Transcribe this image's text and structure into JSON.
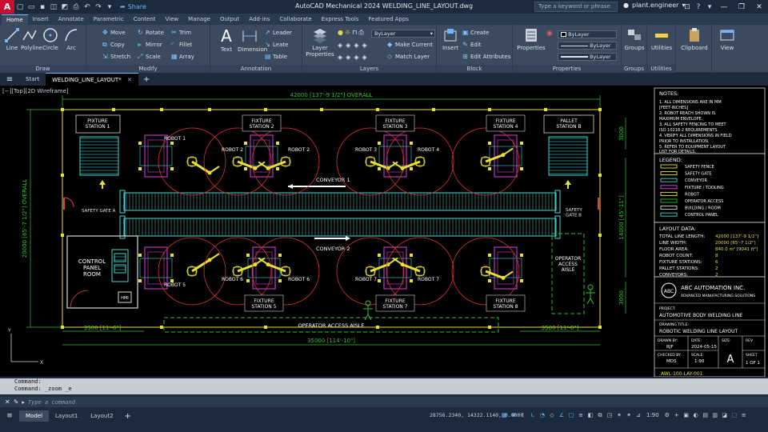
{
  "app": {
    "logo_letter": "A",
    "window_title": "AutoCAD Mechanical 2024    WELDING_LINE_LAYOUT.dwg",
    "share_label": "Share",
    "search_placeholder": "Type a keyword or phrase",
    "username": "plant.engineer"
  },
  "ribbon_tabs": [
    "Home",
    "Insert",
    "Annotate",
    "Parametric",
    "Content",
    "View",
    "Manage",
    "Output",
    "Add-ins",
    "Collaborate",
    "Express Tools",
    "Featured Apps"
  ],
  "ribbon": {
    "draw": {
      "title": "Draw",
      "tools": [
        "Line",
        "Polyline",
        "Circle",
        "Arc"
      ]
    },
    "modify": {
      "title": "Modify",
      "tools": [
        "Move",
        "Rotate",
        "Trim",
        "Copy",
        "Mirror",
        "Fillet",
        "Stretch",
        "Scale",
        "Array"
      ]
    },
    "annotation": {
      "title": "Annotation",
      "tools": [
        "Text",
        "Dimension",
        "Leader",
        "Leate",
        "Table"
      ]
    },
    "layers": {
      "title": "Layers",
      "layer_properties": "Layer Properties",
      "current_layer": "ByLayer",
      "make_current": "Make Current",
      "match_layer": "Match Layer"
    },
    "block": {
      "title": "Block",
      "insert": "Insert",
      "create": "Create",
      "edit": "Edit",
      "edit_attributes": "Edit Attributes"
    },
    "properties": {
      "title": "Properties",
      "label": "Properties",
      "color": "ByLayer",
      "linetype": "ByLayer",
      "lineweight": "ByLayer"
    },
    "groups": {
      "title": "Groups",
      "label": "Groups"
    },
    "utilities": {
      "title": "Utilities",
      "label": "Utilities"
    },
    "clipboard": {
      "label": "Clipboard"
    },
    "view": {
      "label": "View"
    }
  },
  "file_tabs": {
    "start": "Start",
    "active": "WELDING_LINE_LAYOUT*"
  },
  "viewport_label": "[−][Top][2D Wireframe]",
  "drawing": {
    "overall_top": "42000 [137'-9 1/2\"] OVERALL",
    "overall_left": "20000 [65'-7 1/2\"] OVERALL",
    "overall_right": "14000 [45'-11\"]",
    "dim_bottom_total": "35000 [114'-10\"]",
    "dim_bottom_left": "3500 [11'-6\"]",
    "dim_bottom_right": "3500 [11'-6\"]",
    "dim_right_top": "3000",
    "dim_right_bottom": "3000",
    "stations_top": [
      "PIXTURE\nSTATION 1",
      "FIXTURE\nSTATION 2",
      "FIXTURE\nSTATION 3",
      "FIXTURE\nSTATION 4",
      "PALLET\nSTATION B"
    ],
    "stations_bottom": [
      "FIXTURE\nSTATION 5",
      "FIXTURE\nSTATION 7",
      "FIXTURE\nSTATION 8"
    ],
    "robots_top": [
      "ROBOT 1",
      "ROBOT 2",
      "ROBOT 2",
      "ROBOT 3",
      "ROBOT 4"
    ],
    "robots_bottom": [
      "ROBOT 5",
      "ROBOT 6",
      "ROBOT 6",
      "ROBOT 7",
      "ROBOT 7"
    ],
    "conveyor_1": "CONVEYOR 1",
    "conveyor_2": "CONVEYOR 2",
    "safety_gate_a": "SAFETY GATE A",
    "safety_gate_b": "SAFETY\nGATE B",
    "control_room": "CONTROL\nPANEL\nROOM",
    "hmi": "HMI",
    "operator_access": "OPERATOR\nACCESS\nAISLE",
    "operator_aisle": "OPERATOR ACCESS AISLE"
  },
  "notes": {
    "title": "NOTES:",
    "items": [
      "1.  ALL DIMENSIONS ARE IN MM",
      "     [FEET-INCHES]",
      "2.  ROBOT REACH SHOWN IS",
      "     MAXIMUM ENVELOPE.",
      "3.  ALL SAFETY FENCING TO MEET",
      "     ISO 10218-2 REQUIREMENTS.",
      "4.  VERIFY ALL DIMENSIONS IN FIELD",
      "     PRIOR TO INSTALLATION.",
      "5.  REFER TO EQUIPMENT LAYOUT",
      "     LIST FOR DETAILS."
    ]
  },
  "legend": {
    "title": "LEGEND:",
    "items": [
      {
        "label": "SAFETY FENCE",
        "color": "#e8e032"
      },
      {
        "label": "SAFETY GATE",
        "color": "#e8e032"
      },
      {
        "label": "CONVEYOR",
        "color": "#3fd4d4"
      },
      {
        "label": "FIXTURE / TOOLING",
        "color": "#e040e0"
      },
      {
        "label": "ROBOT",
        "color": "#e8e032"
      },
      {
        "label": "OPERATOR ACCESS",
        "color": "#30c030"
      },
      {
        "label": "BUILDING / ROOM",
        "color": "#d8d8d8"
      },
      {
        "label": "CONTROL PANEL",
        "color": "#3fd4d4"
      }
    ]
  },
  "layout_data": {
    "title": "LAYOUT DATA:",
    "rows": [
      {
        "k": "TOTAL LINE LENGTH:",
        "v": "42000 [137'-9 1/2\"]"
      },
      {
        "k": "LINE WIDTH:",
        "v": "20000 [65'-7 1/2\"]"
      },
      {
        "k": "FLOOR AREA:",
        "v": "840.0 m² [9041 ft²]"
      },
      {
        "k": "ROBOT COUNT:",
        "v": "8"
      },
      {
        "k": "FIXTURE STATIONS:",
        "v": "6"
      },
      {
        "k": "PALLET STATIONS:",
        "v": "2"
      },
      {
        "k": "CONVEYORS:",
        "v": "2"
      }
    ]
  },
  "title_block": {
    "logo": "ABC",
    "company": "ABC AUTOMATION INC.",
    "tagline": "ADVANCED MANUFACTURING SOLUTIONS",
    "project_label": "PROJECT:",
    "project": "AUTOMOTIVE BODY WELDING LINE",
    "drawing_title_label": "DRAWING TITLE:",
    "drawing_title": "ROBOTIC WELDING LINE LAYOUT",
    "drawn_by_label": "DRAWN BY:",
    "drawn_by": "RJF",
    "date_label": "DATE:",
    "date": "2024-05-15",
    "size_label": "SIZE:",
    "rev_label": "REV",
    "checked_by_label": "CHECKED BY:",
    "checked_by": "MDS",
    "scale_label": "SCALE:",
    "scale": "1:90",
    "size": "A",
    "sheet_label": "SHEET",
    "sheet": "1 OF 1",
    "drawing_number": "AWL-100-LAY-001"
  },
  "command": {
    "history": [
      "Command:",
      "Command: _zoom _e"
    ],
    "placeholder": "Type a command"
  },
  "status": {
    "layout_tabs": [
      "Model",
      "Layout1",
      "Layout2"
    ],
    "coords": "28756.2340, 14322.1140, 0.0000",
    "model_label": "MODEL",
    "scale": "1:90"
  }
}
